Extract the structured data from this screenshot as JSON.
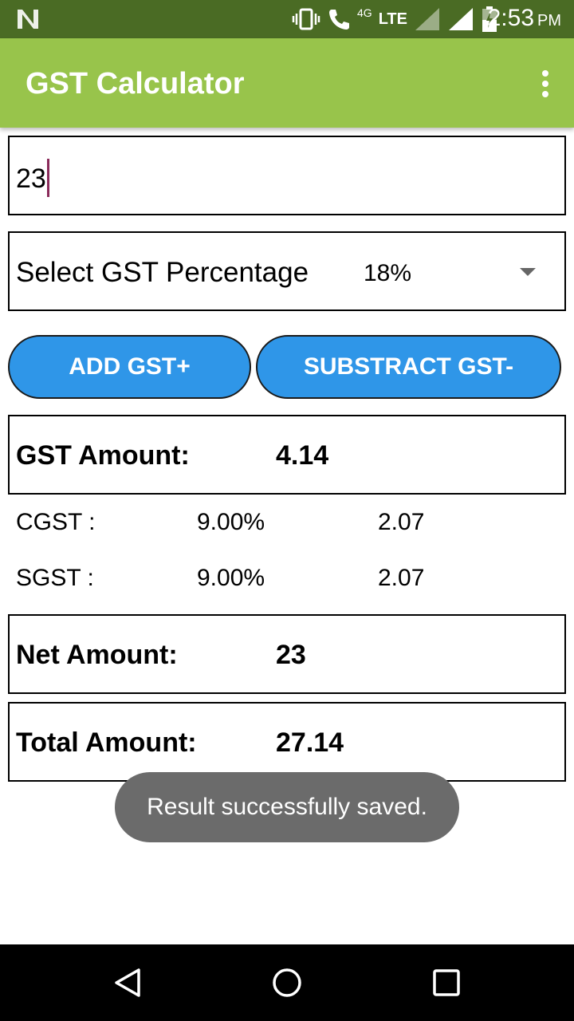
{
  "status_bar": {
    "time": "2:53",
    "ampm": "PM",
    "network": "LTE",
    "network_sub": "4G",
    "icons": [
      "n-logo-icon",
      "vibrate-icon",
      "call-icon",
      "signal-icon",
      "battery-icon"
    ]
  },
  "app_bar": {
    "title": "GST Calculator",
    "menu_icon": "more-vert-icon"
  },
  "amount_input": {
    "value": "23"
  },
  "gst_select": {
    "label": "Select GST Percentage",
    "selected": "18%"
  },
  "buttons": {
    "add": "ADD GST+",
    "subtract": "SUBSTRACT GST-"
  },
  "results": {
    "gst_amount_label": "GST Amount:",
    "gst_amount_value": "4.14",
    "cgst_label": "CGST :",
    "cgst_rate": "9.00%",
    "cgst_value": "2.07",
    "sgst_label": "SGST :",
    "sgst_rate": "9.00%",
    "sgst_value": "2.07",
    "net_amount_label": "Net Amount:",
    "net_amount_value": "23",
    "total_amount_label": "Total Amount:",
    "total_amount_value": "27.14"
  },
  "toast": {
    "message": "Result successfully saved."
  },
  "nav_bar": {
    "icons": [
      "back-icon",
      "home-icon",
      "recents-icon"
    ]
  },
  "colors": {
    "status_bar": "#4a6b24",
    "app_bar": "#98c44b",
    "button": "#2f96e8",
    "toast": "#6b6b6b"
  }
}
